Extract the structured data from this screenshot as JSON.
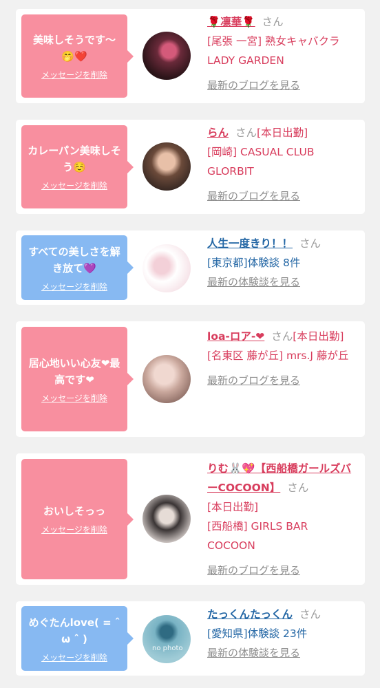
{
  "entries": [
    {
      "message": "美味しそうです〜🤭❤️",
      "delete_label": "メッセージを削除",
      "name": "🌹凛華🌹",
      "honorific": "さん",
      "status": "",
      "shop": "[尾張 一宮] 熟女キャバクラ LADY GARDEN",
      "link": "最新のブログを見る"
    },
    {
      "message": "カレーパン美味しそう☺️",
      "delete_label": "メッセージを削除",
      "name": "らん",
      "honorific": "さん",
      "status": "[本日出勤]",
      "shop": "[岡崎] CASUAL CLUB GLORBIT",
      "link": "最新のブログを見る"
    },
    {
      "message": "すべての美しさを解き放て💜",
      "delete_label": "メッセージを削除",
      "name": "人生一度きり！！",
      "honorific": "さん",
      "status": "",
      "shop": "[東京都]体験談 8件",
      "link": "最新の体験談を見る"
    },
    {
      "message": "居心地いい心友❤最高です❤",
      "delete_label": "メッセージを削除",
      "name": "loa-ロア-❤",
      "honorific": "さん",
      "status": "[本日出勤]",
      "shop": "[名東区 藤が丘] mrs.J 藤が丘",
      "link": "最新のブログを見る"
    },
    {
      "message": "おいしそっっ",
      "delete_label": "メッセージを削除",
      "name": "りむ🐰💖【西船橋ガールズバーCOCOON】",
      "honorific": "さん",
      "status": "[本日出勤]",
      "shop": "[西船橋] GIRLS BAR COCOON",
      "link": "最新のブログを見る"
    },
    {
      "message": "めぐたんlove( = ˆ ω ˆ )",
      "delete_label": "メッセージを削除",
      "name": "たっくんたっくん",
      "honorific": "さん",
      "status": "",
      "shop": "[愛知県]体験談 23件",
      "link": "最新の体験談を見る",
      "avatar_placeholder": "no photo"
    }
  ],
  "colors": {
    "pink_bubble": "#f88f9f",
    "blue_bubble": "#87b9f2",
    "pink_text": "#d83d5d",
    "blue_text": "#2467a5"
  }
}
